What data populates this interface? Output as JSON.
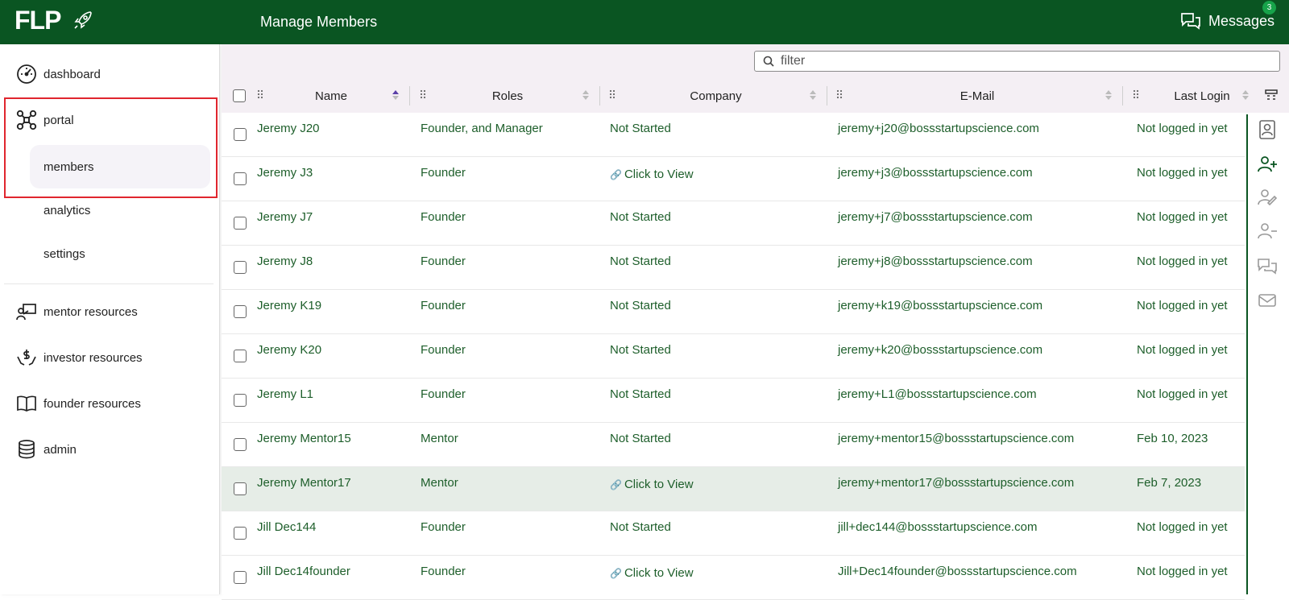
{
  "header": {
    "logo_text": "FLP",
    "page_title": "Manage Members",
    "messages_label": "Messages",
    "messages_count": "3"
  },
  "sidebar": {
    "items": [
      {
        "label": "dashboard",
        "icon": "dashboard-gauge-icon"
      },
      {
        "label": "portal",
        "icon": "portal-drone-icon"
      },
      {
        "label": "members",
        "icon": ""
      },
      {
        "label": "analytics",
        "icon": ""
      },
      {
        "label": "settings",
        "icon": ""
      },
      {
        "label": "mentor resources",
        "icon": "mentor-board-icon"
      },
      {
        "label": "investor resources",
        "icon": "investor-hands-icon"
      },
      {
        "label": "founder resources",
        "icon": "book-icon"
      },
      {
        "label": "admin",
        "icon": "database-icon"
      }
    ],
    "active_item": "members"
  },
  "filter": {
    "placeholder": "filter",
    "value": ""
  },
  "table": {
    "columns": [
      "Name",
      "Roles",
      "Company",
      "E-Mail",
      "Last Login"
    ],
    "sorted_column": "Name",
    "sort_direction": "ascending",
    "rows": [
      {
        "name": "Jeremy J20",
        "roles": "Founder, and Manager",
        "company": "Not Started",
        "email": "jeremy+j20@bossstartupscience.com",
        "last_login": "Not logged in yet",
        "selected": false
      },
      {
        "name": "Jeremy J3",
        "roles": "Founder",
        "company": "Click to View",
        "email": "jeremy+j3@bossstartupscience.com",
        "last_login": "Not logged in yet",
        "selected": false
      },
      {
        "name": "Jeremy J7",
        "roles": "Founder",
        "company": "Not Started",
        "email": "jeremy+j7@bossstartupscience.com",
        "last_login": "Not logged in yet",
        "selected": false
      },
      {
        "name": "Jeremy J8",
        "roles": "Founder",
        "company": "Not Started",
        "email": "jeremy+j8@bossstartupscience.com",
        "last_login": "Not logged in yet",
        "selected": false
      },
      {
        "name": "Jeremy K19",
        "roles": "Founder",
        "company": "Not Started",
        "email": "jeremy+k19@bossstartupscience.com",
        "last_login": "Not logged in yet",
        "selected": false
      },
      {
        "name": "Jeremy K20",
        "roles": "Founder",
        "company": "Not Started",
        "email": "jeremy+k20@bossstartupscience.com",
        "last_login": "Not logged in yet",
        "selected": false
      },
      {
        "name": "Jeremy L1",
        "roles": "Founder",
        "company": "Not Started",
        "email": "jeremy+L1@bossstartupscience.com",
        "last_login": "Not logged in yet",
        "selected": false
      },
      {
        "name": "Jeremy Mentor15",
        "roles": "Mentor",
        "company": "Not Started",
        "email": "jeremy+mentor15@bossstartupscience.com",
        "last_login": "Feb 10, 2023",
        "selected": false
      },
      {
        "name": "Jeremy Mentor17",
        "roles": "Mentor",
        "company": "Click to View",
        "email": "jeremy+mentor17@bossstartupscience.com",
        "last_login": "Feb 7, 2023",
        "selected": true
      },
      {
        "name": "Jill Dec144",
        "roles": "Founder",
        "company": "Not Started",
        "email": "jill+dec144@bossstartupscience.com",
        "last_login": "Not logged in yet",
        "selected": false
      },
      {
        "name": "Jill Dec14founder",
        "roles": "Founder",
        "company": "Click to View",
        "email": "Jill+Dec14founder@bossstartupscience.com",
        "last_login": "Not logged in yet",
        "selected": false
      }
    ]
  },
  "right_rail": {
    "icons": [
      "contact-card-icon",
      "add-user-icon",
      "edit-user-icon",
      "remove-user-icon",
      "chat-icon",
      "mail-icon"
    ]
  },
  "colors": {
    "brand_green": "#0a5522",
    "text_green": "#1d5e2a",
    "highlight_red": "#e0262e",
    "selected_row": "#e6ede7",
    "header_bg": "#f4eff4"
  }
}
